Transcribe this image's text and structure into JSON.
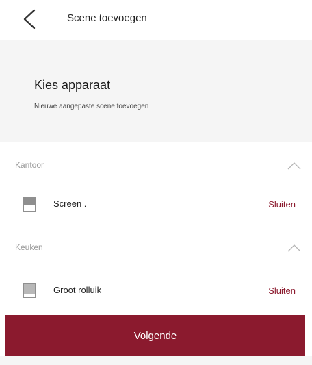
{
  "header": {
    "title": "Scene toevoegen",
    "back_icon": "chevron-left-icon"
  },
  "intro": {
    "title": "Kies apparaat",
    "subtitle": "Nieuwe aangepaste scene toevoegen"
  },
  "rooms": [
    {
      "name": "Kantoor",
      "expanded": true,
      "devices": [
        {
          "name": "Screen .",
          "action": "Sluiten",
          "icon": "screen-blind-icon"
        }
      ]
    },
    {
      "name": "Keuken",
      "expanded": true,
      "devices": [
        {
          "name": "Groot rolluik",
          "action": "Sluiten",
          "icon": "roller-shutter-icon"
        }
      ]
    }
  ],
  "footer": {
    "next_label": "Volgende"
  },
  "colors": {
    "accent": "#8b1a2e",
    "panel": "#f5f5f5",
    "muted_text": "#9a9a9a"
  }
}
